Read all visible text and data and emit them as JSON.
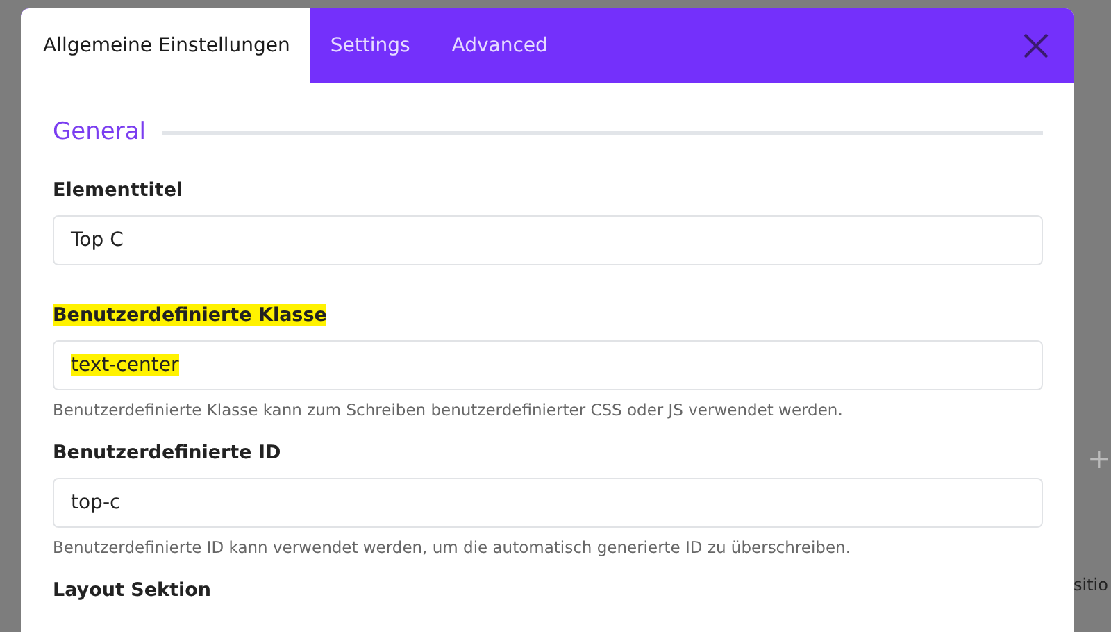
{
  "tabs": [
    {
      "label": "Allgemeine Einstellungen",
      "selected": true
    },
    {
      "label": "Settings",
      "selected": false
    },
    {
      "label": "Advanced",
      "selected": false
    }
  ],
  "section": {
    "title": "General"
  },
  "fields": [
    {
      "label": "Elementtitel",
      "value": "Top C",
      "highlighted": false
    },
    {
      "label": "Benutzerdefinierte Klasse",
      "value": "text-center",
      "help": "Benutzerdefinierte Klasse kann zum Schreiben benutzerdefinierter CSS oder JS verwendet werden.",
      "highlighted": true
    },
    {
      "label": "Benutzerdefinierte ID",
      "value": "top-c",
      "help": "Benutzerdefinierte ID kann verwendet werden, um die automatisch generierte ID zu überschreiben.",
      "highlighted": false
    }
  ],
  "next_section_label": "Layout Sektion",
  "background": {
    "plus": "+",
    "text": "sitio"
  }
}
